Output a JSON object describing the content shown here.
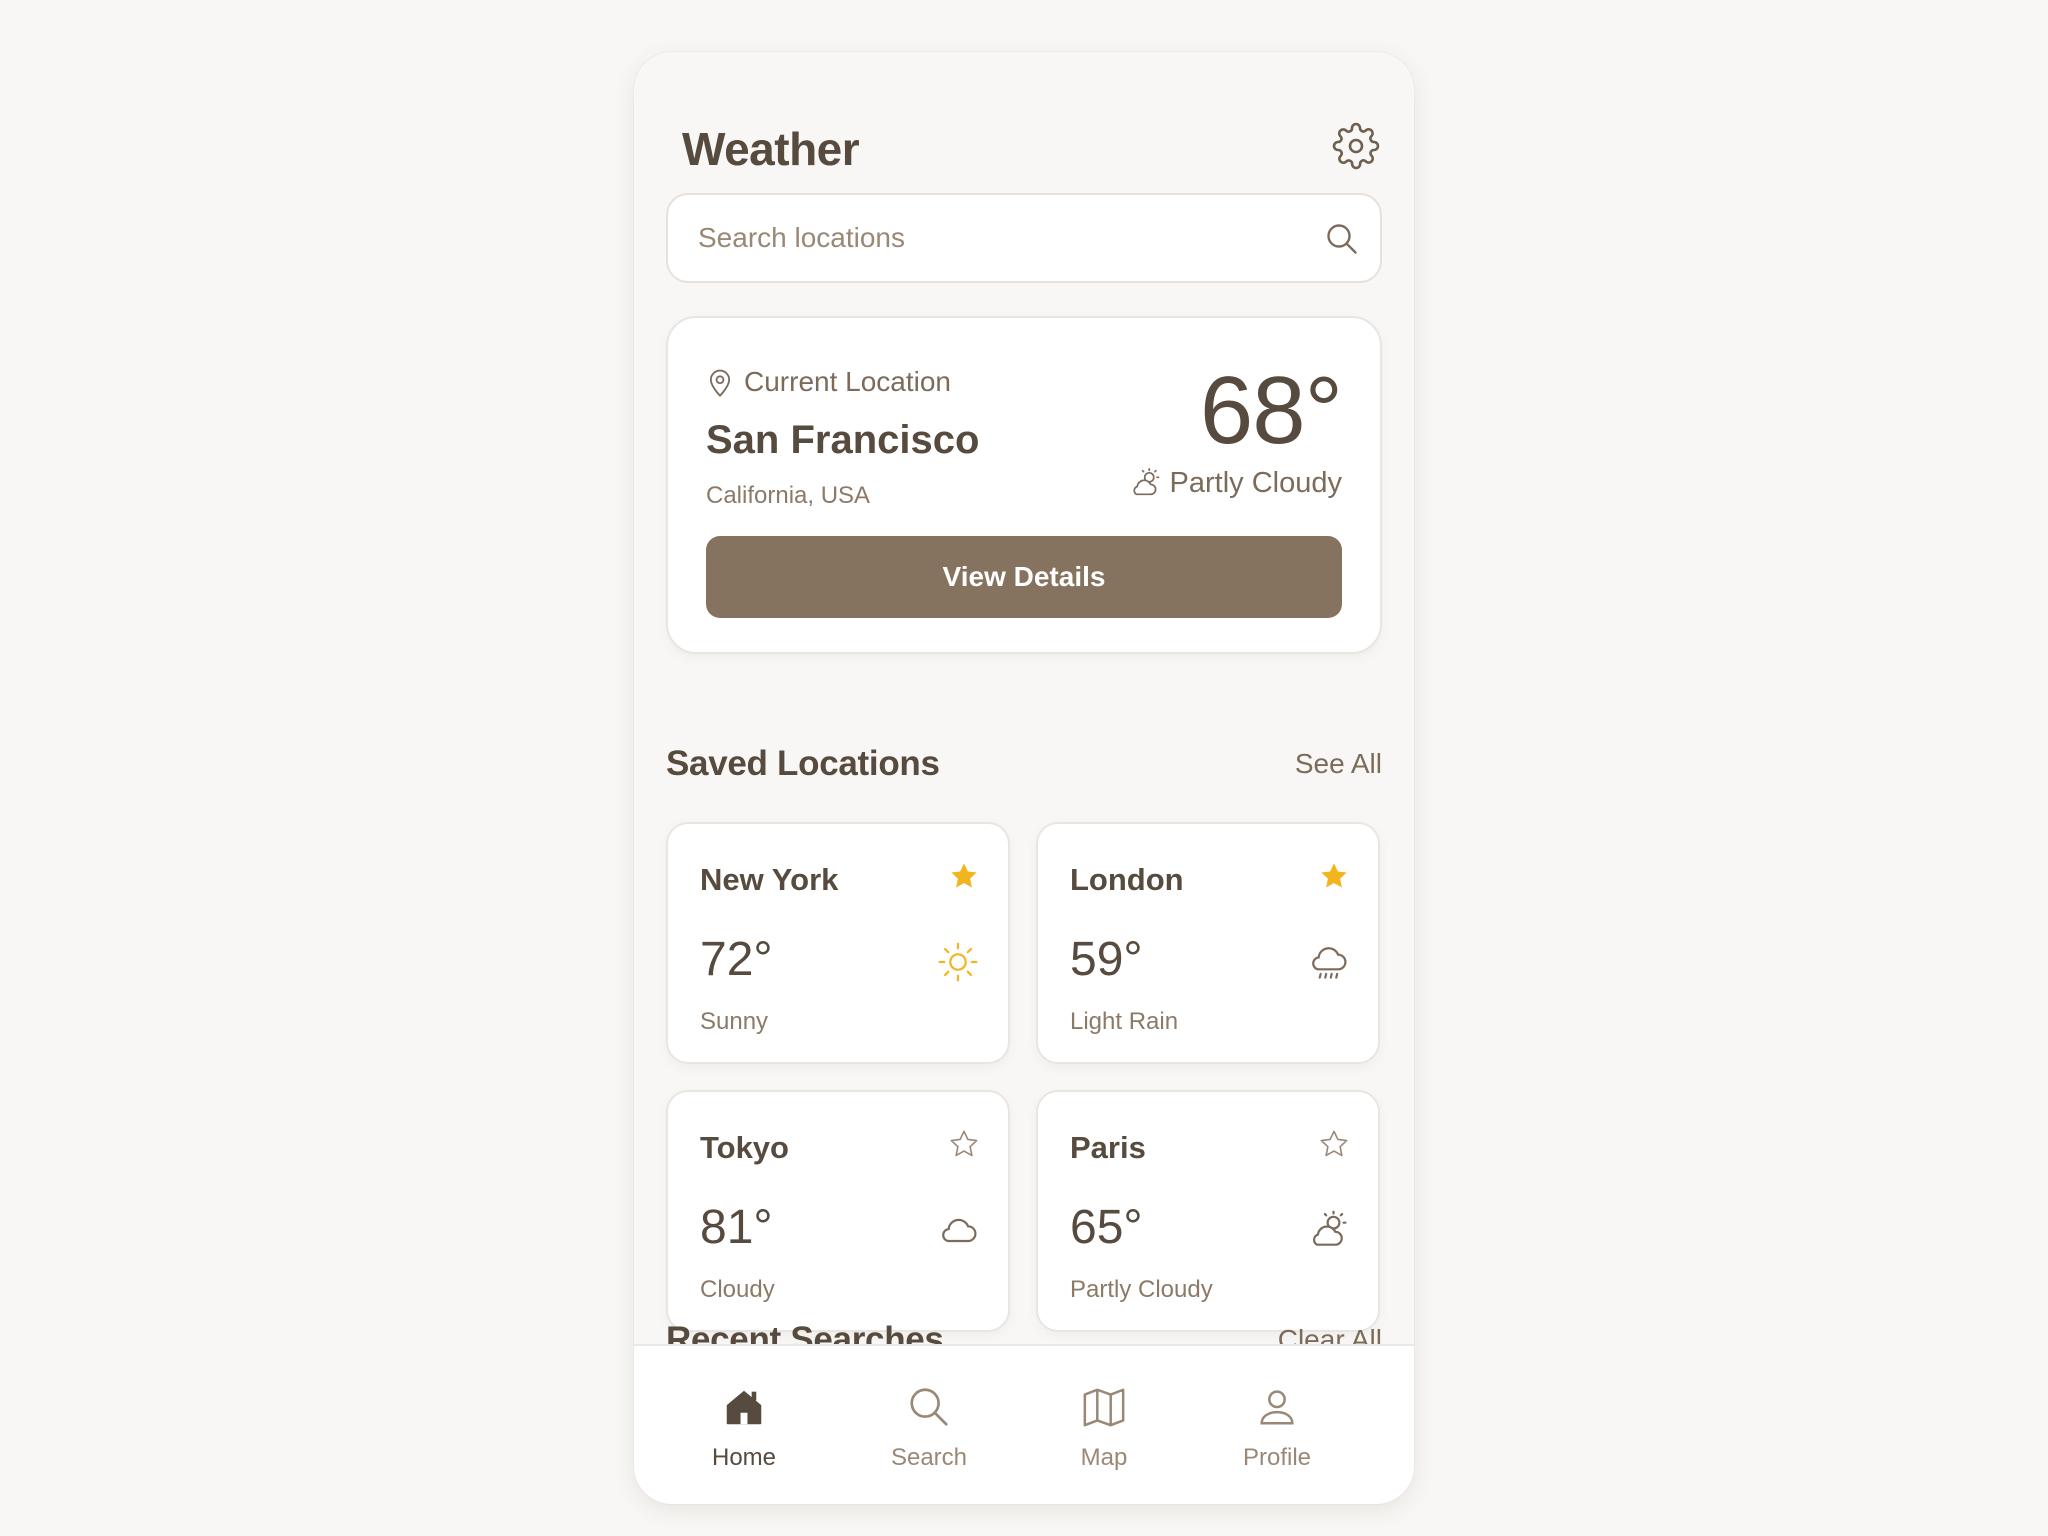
{
  "app": {
    "title": "Weather"
  },
  "search": {
    "placeholder": "Search locations"
  },
  "current": {
    "label": "Current Location",
    "city": "San Francisco",
    "region": "California, USA",
    "temp": "68°",
    "condition": "Partly Cloudy",
    "button_label": "View Details"
  },
  "saved": {
    "title": "Saved Locations",
    "action": "See All",
    "items": [
      {
        "city": "New York",
        "temp": "72°",
        "condition": "Sunny",
        "favorite": true,
        "icon": "sun-icon"
      },
      {
        "city": "London",
        "temp": "59°",
        "condition": "Light Rain",
        "favorite": true,
        "icon": "rain-cloud-icon"
      },
      {
        "city": "Tokyo",
        "temp": "81°",
        "condition": "Cloudy",
        "favorite": false,
        "icon": "cloud-icon"
      },
      {
        "city": "Paris",
        "temp": "65°",
        "condition": "Partly Cloudy",
        "favorite": false,
        "icon": "partly-cloudy-icon"
      }
    ]
  },
  "recent": {
    "title": "Recent Searches",
    "action": "Clear All"
  },
  "nav": {
    "items": [
      {
        "label": "Home",
        "icon": "home-icon",
        "active": true
      },
      {
        "label": "Search",
        "icon": "search-icon",
        "active": false
      },
      {
        "label": "Map",
        "icon": "map-icon",
        "active": false
      },
      {
        "label": "Profile",
        "icon": "profile-icon",
        "active": false
      }
    ]
  },
  "colors": {
    "background": "#f8f7f5",
    "text": "#574a3e",
    "muted": "#8c7a68",
    "accent_button": "#85725f",
    "star_active": "#f2b51d",
    "sun": "#f2b51d"
  }
}
